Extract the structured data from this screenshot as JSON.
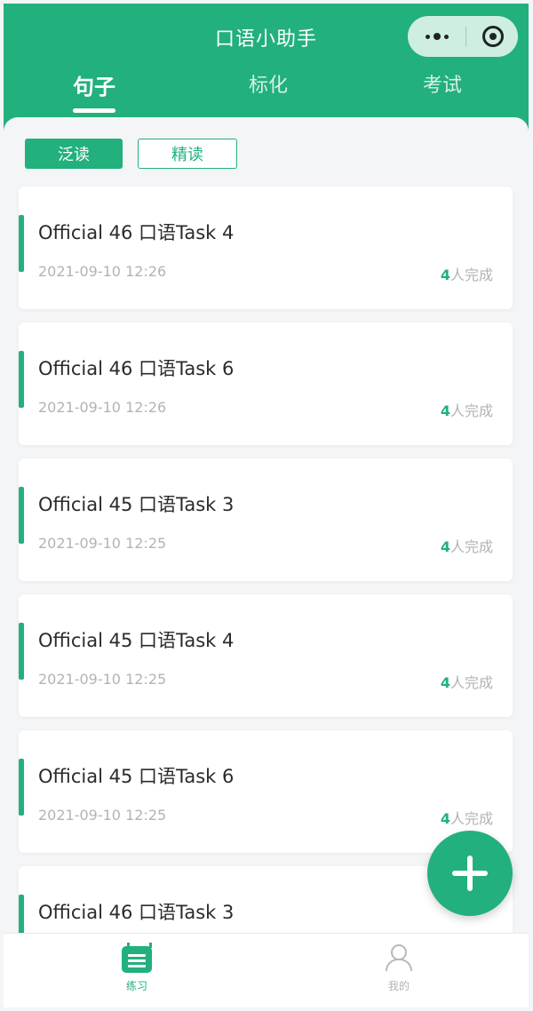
{
  "colors": {
    "brand": "#22b07d",
    "background": "#f4f5f7",
    "muted": "#b3b3b3"
  },
  "header": {
    "title": "口语小助手",
    "tabs": [
      "句子",
      "标化",
      "考试"
    ],
    "active_tab": 0,
    "capsule": {
      "more_icon": "more-dots-icon",
      "close_icon": "target-close-icon"
    }
  },
  "filters": {
    "extensive": "泛读",
    "intensive": "精读",
    "active": "泛读"
  },
  "items": [
    {
      "title": "Official 46 口语Task 4",
      "time": "2021-09-10 12:26",
      "count": "4",
      "done_suffix": "人完成"
    },
    {
      "title": "Official 46 口语Task 6",
      "time": "2021-09-10 12:26",
      "count": "4",
      "done_suffix": "人完成"
    },
    {
      "title": "Official 45 口语Task 3",
      "time": "2021-09-10 12:25",
      "count": "4",
      "done_suffix": "人完成"
    },
    {
      "title": "Official 45 口语Task 4",
      "time": "2021-09-10 12:25",
      "count": "4",
      "done_suffix": "人完成"
    },
    {
      "title": "Official 45 口语Task 6",
      "time": "2021-09-10 12:25",
      "count": "4",
      "done_suffix": "人完成"
    },
    {
      "title": "Official 46 口语Task 3",
      "time": "",
      "count": "",
      "done_suffix": ""
    }
  ],
  "fab": {
    "icon": "plus-icon"
  },
  "tabbar": {
    "practice": {
      "label": "练习",
      "icon": "calendar-icon"
    },
    "mine": {
      "label": "我的",
      "icon": "user-icon"
    }
  }
}
